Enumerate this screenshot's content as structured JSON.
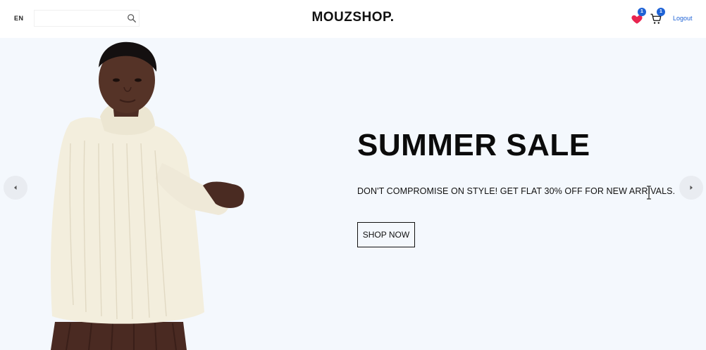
{
  "header": {
    "language": "EN",
    "search": {
      "value": "",
      "placeholder": ""
    },
    "logo": "MOUZSHOP.",
    "wishlist_count": "1",
    "cart_count": "1",
    "logout_label": "Logout"
  },
  "hero": {
    "title": "SUMMER SALE",
    "description": "DON'T COMPROMISE ON STYLE! GET FLAT 30% OFF FOR NEW ARRIVALS.",
    "button_label": "SHOP NOW"
  },
  "icons": {
    "search": "search-icon",
    "wishlist": "heart-icon",
    "cart": "cart-icon",
    "prev": "arrow-left-icon",
    "next": "arrow-right-icon"
  },
  "colors": {
    "hero_background": "#f4f8fd",
    "heart": "#e8244f",
    "badge": "#1f63d6",
    "logout_link": "#1f63d6"
  }
}
